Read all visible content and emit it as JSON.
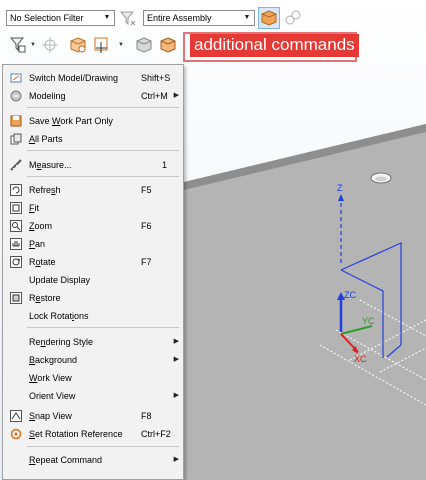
{
  "toolbar": {
    "selection_filter": "No Selection Filter",
    "assembly_scope": "Entire Assembly"
  },
  "callout": {
    "text": "additional commands",
    "color": "#e53935"
  },
  "menu": {
    "items": [
      {
        "label": "Switch Model/Drawing",
        "shortcut": "Shift+S",
        "icon": "switch-model-icon"
      },
      {
        "label": "Modeling",
        "shortcut": "Ctrl+M",
        "icon": "modeling-icon",
        "submenu": true
      },
      {
        "label": "Save Work Part Only",
        "icon": "save-work-part-icon"
      },
      {
        "label": "All Parts",
        "icon": "all-parts-icon"
      },
      {
        "label": "Measure...",
        "shortcut": "1",
        "icon": "measure-icon"
      },
      {
        "label": "Refresh",
        "shortcut": "F5",
        "icon": "refresh-icon"
      },
      {
        "label": "Fit",
        "icon": "fit-icon"
      },
      {
        "label": "Zoom",
        "shortcut": "F6",
        "icon": "zoom-icon"
      },
      {
        "label": "Pan",
        "icon": "pan-icon"
      },
      {
        "label": "Rotate",
        "shortcut": "F7",
        "icon": "rotate-icon"
      },
      {
        "label": "Update Display"
      },
      {
        "label": "Restore",
        "icon": "restore-icon"
      },
      {
        "label": "Lock Rotations"
      },
      {
        "label": "Rendering Style",
        "submenu": true
      },
      {
        "label": "Background",
        "submenu": true
      },
      {
        "label": "Work View"
      },
      {
        "label": "Orient View",
        "submenu": true
      },
      {
        "label": "Snap View",
        "shortcut": "F8",
        "icon": "snap-view-icon"
      },
      {
        "label": "Set Rotation Reference",
        "shortcut": "Ctrl+F2",
        "icon": "rotation-reference-icon"
      },
      {
        "label": "Repeat Command",
        "submenu": true
      }
    ]
  },
  "triad": {
    "z_label": "Z",
    "zc_label": "ZC",
    "yc_label": "YC",
    "xc_label": "XC",
    "colors": {
      "z": "#1f3fe0",
      "y": "#2aa02a",
      "x": "#e02020"
    }
  }
}
